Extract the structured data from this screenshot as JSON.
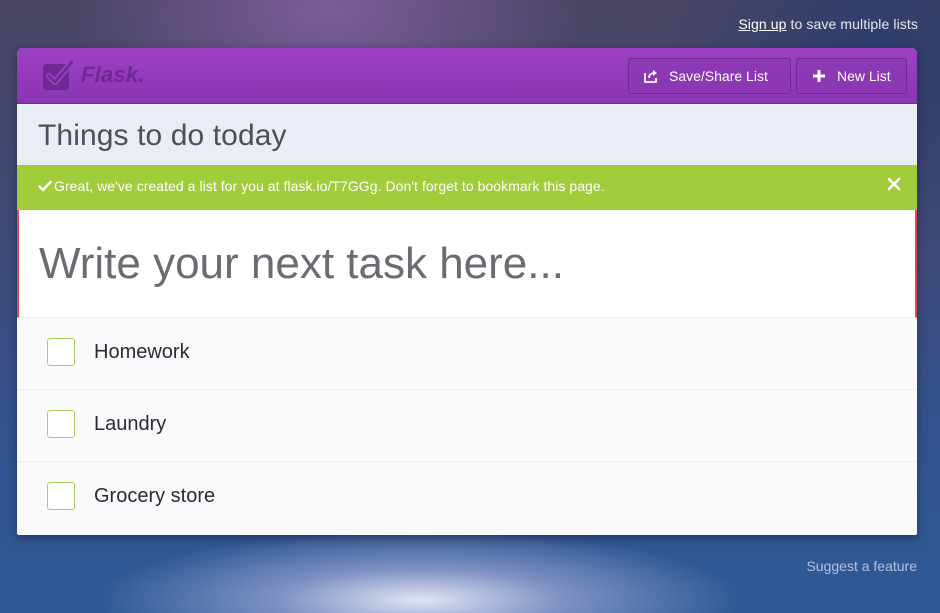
{
  "top_link": {
    "signup_label": "Sign up",
    "rest_text": "to save multiple lists"
  },
  "header": {
    "logo_text": "Flask.",
    "logo_icon": "checkbox-logo-icon",
    "buttons": {
      "save_share": {
        "label": "Save/Share List",
        "icon": "share-icon"
      },
      "new_list": {
        "label": "New List",
        "icon": "plus-icon"
      }
    },
    "colors": {
      "header_bg": "#9d41c4",
      "accent_green": "#a1cd3c"
    }
  },
  "list": {
    "title": "Things to do today"
  },
  "alert": {
    "message": "Great, we've created a list for you at flask.io/T7GGg. Don't forget to bookmark this page.",
    "check_icon": "check-icon",
    "close_icon": "close-icon"
  },
  "task_input": {
    "placeholder": "Write your next task here...",
    "value": ""
  },
  "tasks": [
    {
      "label": "Homework",
      "checked": false
    },
    {
      "label": "Laundry",
      "checked": false
    },
    {
      "label": "Grocery store",
      "checked": false
    }
  ],
  "footer": {
    "suggest_label": "Suggest a feature"
  }
}
